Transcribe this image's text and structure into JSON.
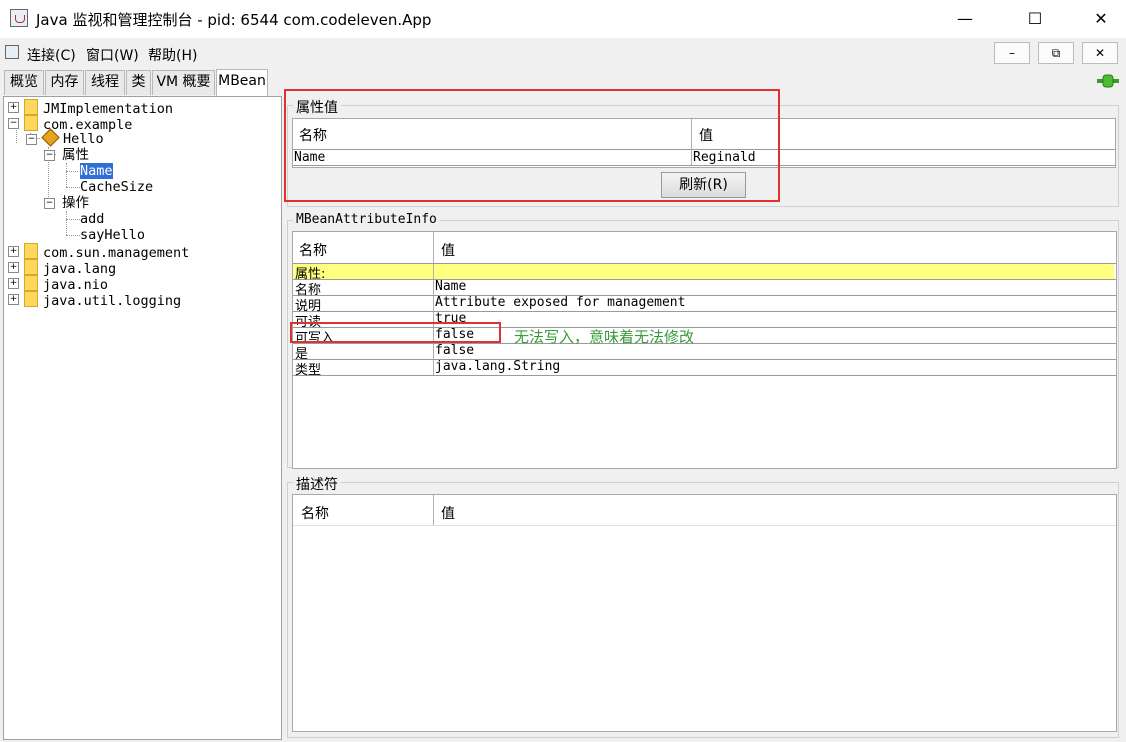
{
  "window": {
    "title": "Java 监视和管理控制台 - pid: 6544 com.codeleven.App",
    "minimize": "—",
    "maximize": "☐",
    "close": "✕"
  },
  "menu": {
    "items": [
      "连接(C)",
      "窗口(W)",
      "帮助(H)"
    ],
    "mdi_buttons": [
      "–",
      "⧉",
      "✕"
    ]
  },
  "tabs": [
    "概览",
    "内存",
    "线程",
    "类",
    "VM 概要",
    "MBean"
  ],
  "selected_tab": "MBean",
  "tree": {
    "nodes": [
      "JMImplementation",
      "com.example",
      "Hello",
      "属性",
      "Name",
      "CacheSize",
      "操作",
      "add",
      "sayHello",
      "com.sun.management",
      "java.lang",
      "java.nio",
      "java.util.logging"
    ],
    "selected": "Name"
  },
  "attr_values": {
    "title": "属性值",
    "headers": [
      "名称",
      "值"
    ],
    "rows": [
      [
        "Name",
        "Reginald"
      ]
    ],
    "refresh_button": "刷新(R)"
  },
  "attr_info": {
    "title": "MBeanAttributeInfo",
    "headers": [
      "名称",
      "值"
    ],
    "rows": [
      [
        "属性:",
        ""
      ],
      [
        "名称",
        "Name"
      ],
      [
        "说明",
        "Attribute exposed for management"
      ],
      [
        "可读",
        "true"
      ],
      [
        "可写入",
        "false"
      ],
      [
        "是",
        "false"
      ],
      [
        "类型",
        "java.lang.String"
      ]
    ]
  },
  "descriptor": {
    "title": "描述符",
    "headers": [
      "名称",
      "值"
    ]
  },
  "annotation": "无法写入，意味着无法修改",
  "colors": {
    "highlight_row": "#ffff80",
    "annotation_box": "#e03030",
    "annotation_text": "#3a9a3a",
    "selection": "#2f6fd6"
  }
}
